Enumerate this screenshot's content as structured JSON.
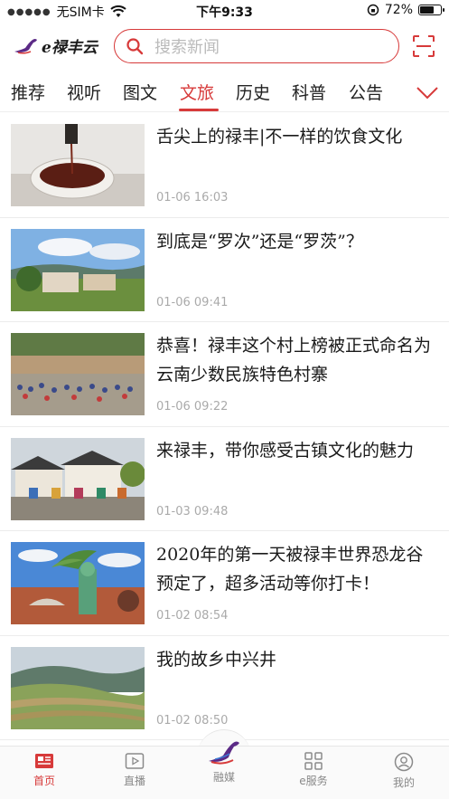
{
  "status_bar": {
    "carrier": "无SIM卡",
    "time": "下午9:33",
    "battery_percent": "72%",
    "battery_level": 0.72
  },
  "header": {
    "logo_text": "e禄丰云",
    "search_placeholder": "搜索新闻"
  },
  "tabs": [
    {
      "label": "推荐",
      "active": false
    },
    {
      "label": "视听",
      "active": false
    },
    {
      "label": "图文",
      "active": false
    },
    {
      "label": "文旅",
      "active": true
    },
    {
      "label": "历史",
      "active": false
    },
    {
      "label": "科普",
      "active": false
    },
    {
      "label": "公告",
      "active": false
    }
  ],
  "news": [
    {
      "title": "舌尖上的禄丰|不一样的饮食文化",
      "time": "01-06 16:03"
    },
    {
      "title": "到底是“罗次”还是“罗茨”？",
      "time": "01-06 09:41"
    },
    {
      "title": "恭喜！禄丰这个村上榜被正式命名为云南少数民族特色村寨",
      "time": "01-06 09:22"
    },
    {
      "title": "来禄丰，带你感受古镇文化的魅力",
      "time": "01-03 09:48"
    },
    {
      "title": "2020年的第一天被禄丰世界恐龙谷预定了，超多活动等你打卡！",
      "time": "01-02 08:54"
    },
    {
      "title": "我的故乡中兴井",
      "time": "01-02 08:50"
    }
  ],
  "bottom_nav": [
    {
      "label": "首页",
      "icon": "news-home-icon",
      "active": true
    },
    {
      "label": "直播",
      "icon": "live-play-icon",
      "active": false
    },
    {
      "label": "融媒",
      "icon": "dinosaur-logo-icon",
      "active": false
    },
    {
      "label": "e服务",
      "icon": "grid-services-icon",
      "active": false
    },
    {
      "label": "我的",
      "icon": "profile-icon",
      "active": false
    }
  ],
  "colors": {
    "accent": "#d73a3a",
    "text": "#1a1a1a",
    "muted": "#aaaaaa"
  }
}
